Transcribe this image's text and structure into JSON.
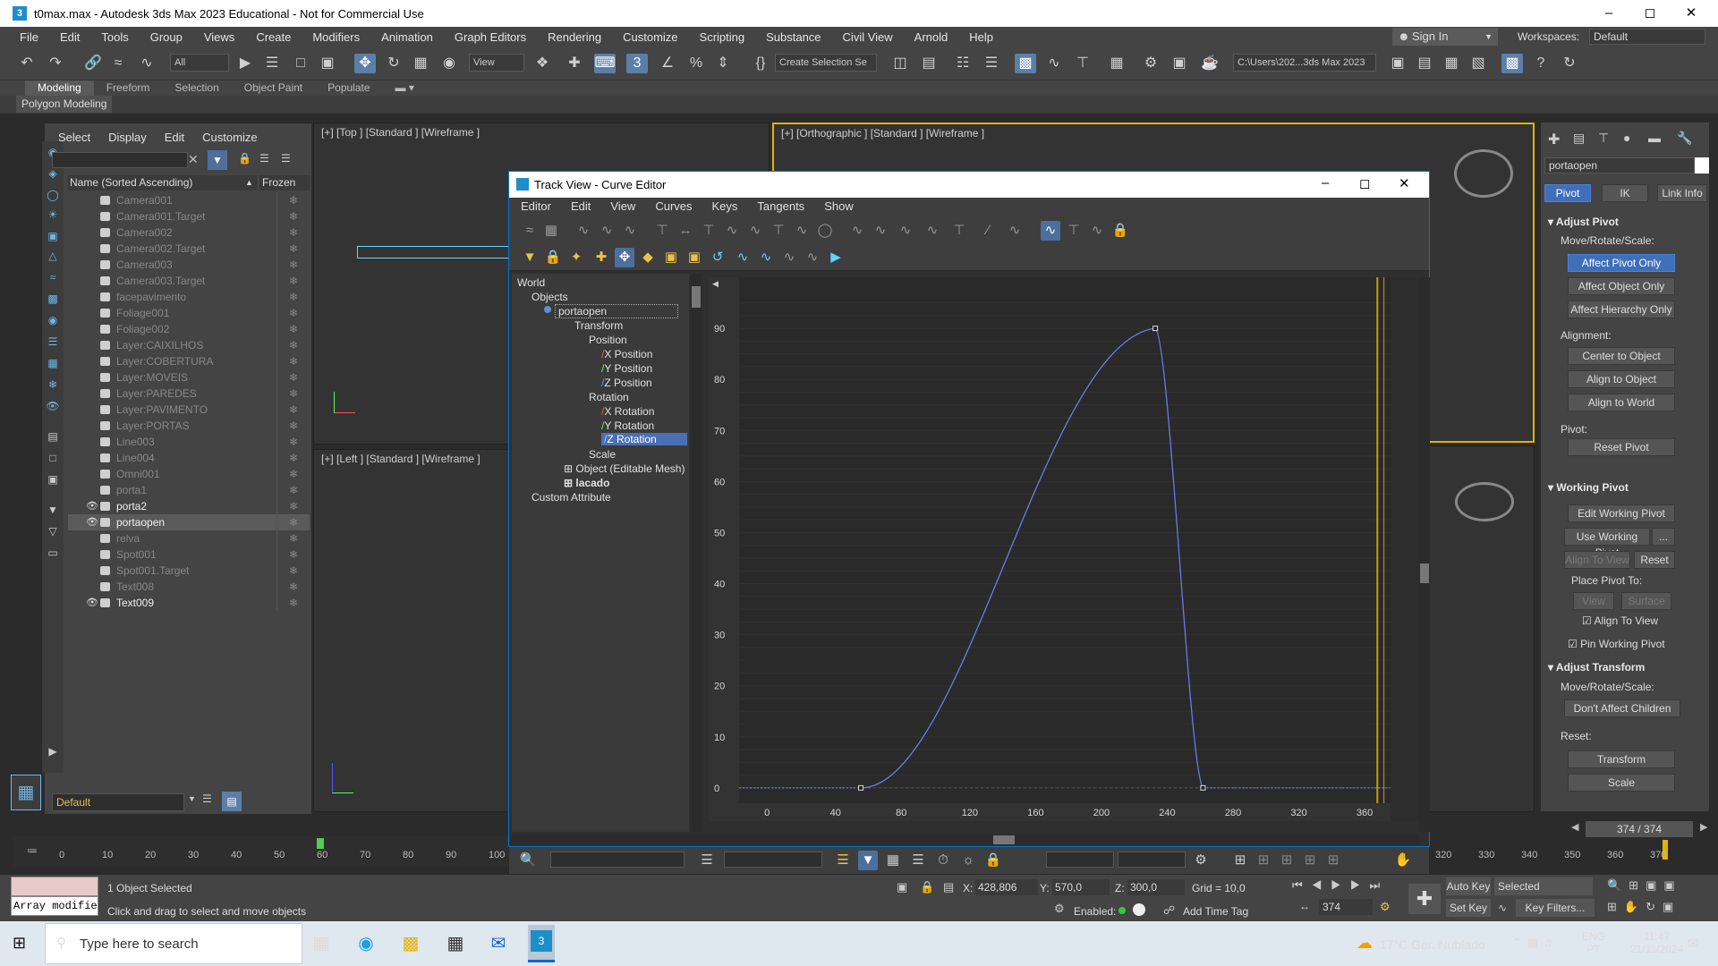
{
  "window": {
    "title": "t0max.max - Autodesk 3ds Max 2023 Educational - Not for Commercial Use",
    "app_icon": "3"
  },
  "menus": [
    "File",
    "Edit",
    "Tools",
    "Group",
    "Views",
    "Create",
    "Modifiers",
    "Animation",
    "Graph Editors",
    "Rendering",
    "Customize",
    "Scripting",
    "Substance",
    "Civil View",
    "Arnold",
    "Help"
  ],
  "account": {
    "sign_in": "Sign In",
    "workspaces_label": "Workspaces:",
    "workspace_value": "Default"
  },
  "toolbar": {
    "filter": "All",
    "ref_coord": "View",
    "selection_set": "Create Selection Se",
    "path": "C:\\Users\\202...3ds Max 2023"
  },
  "ribbon": {
    "tabs": [
      "Modeling",
      "Freeform",
      "Selection",
      "Object Paint",
      "Populate"
    ],
    "panel": "Polygon Modeling"
  },
  "scene_explorer": {
    "menu": [
      "Select",
      "Display",
      "Edit",
      "Customize"
    ],
    "col_name": "Name (Sorted Ascending)",
    "col_frozen": "Frozen",
    "items": [
      {
        "name": "Camera001",
        "vis": false
      },
      {
        "name": "Camera001.Target",
        "vis": false
      },
      {
        "name": "Camera002",
        "vis": false
      },
      {
        "name": "Camera002.Target",
        "vis": false
      },
      {
        "name": "Camera003",
        "vis": false
      },
      {
        "name": "Camera003.Target",
        "vis": false
      },
      {
        "name": "facepavimento",
        "vis": false
      },
      {
        "name": "Foliage001",
        "vis": false
      },
      {
        "name": "Foliage002",
        "vis": false
      },
      {
        "name": "Layer:CAIXILHOS",
        "vis": false
      },
      {
        "name": "Layer:COBERTURA",
        "vis": false
      },
      {
        "name": "Layer:MOVEIS",
        "vis": false
      },
      {
        "name": "Layer:PAREDES",
        "vis": false
      },
      {
        "name": "Layer:PAVIMENTO",
        "vis": false
      },
      {
        "name": "Layer:PORTAS",
        "vis": false
      },
      {
        "name": "Line003",
        "vis": false
      },
      {
        "name": "Line004",
        "vis": false
      },
      {
        "name": "Omni001",
        "vis": false
      },
      {
        "name": "porta1",
        "vis": false
      },
      {
        "name": "porta2",
        "vis": true
      },
      {
        "name": "portaopen",
        "vis": true,
        "selected": true
      },
      {
        "name": "relva",
        "vis": false
      },
      {
        "name": "Spot001",
        "vis": false
      },
      {
        "name": "Spot001.Target",
        "vis": false
      },
      {
        "name": "Text008",
        "vis": false
      },
      {
        "name": "Text009",
        "vis": true
      }
    ],
    "layer": "Default"
  },
  "viewports": {
    "top": "[+] [Top ] [Standard ] [Wireframe ]",
    "ortho": "[+] [Orthographic ] [Standard ] [Wireframe ]",
    "left": "[+] [Left ] [Standard ] [Wireframe ]"
  },
  "track_view": {
    "title": "Track View - Curve Editor",
    "menu": [
      "Editor",
      "Edit",
      "View",
      "Curves",
      "Keys",
      "Tangents",
      "Show"
    ],
    "tree": {
      "world": "World",
      "objects": "Objects",
      "object": "portaopen",
      "transform": "Transform",
      "position": "Position",
      "x_pos": "X Position",
      "y_pos": "Y Position",
      "z_pos": "Z Position",
      "rotation": "Rotation",
      "x_rot": "X Rotation",
      "y_rot": "Y Rotation",
      "z_rot": "Z Rotation",
      "scale": "Scale",
      "editable": "Object (Editable Mesh)",
      "lacado": "lacado",
      "custom": "Custom Attribute"
    },
    "chart_data": {
      "type": "line",
      "y_ticks": [
        0,
        10,
        20,
        30,
        40,
        50,
        60,
        70,
        80,
        90
      ],
      "x_ticks": [
        0,
        40,
        80,
        120,
        160,
        200,
        240,
        280,
        320,
        360
      ],
      "ylim": [
        -3,
        100
      ],
      "xlim": [
        -18,
        378
      ],
      "keys": [
        {
          "x": 56,
          "y": 0
        },
        {
          "x": 235,
          "y": 90
        },
        {
          "x": 264,
          "y": 0
        }
      ],
      "current_frame": 374,
      "end_frame": 370
    }
  },
  "command_panel": {
    "object_name": "portaopen",
    "tabs": [
      "Pivot",
      "IK",
      "Link Info"
    ],
    "adjust_pivot": "Adjust Pivot",
    "move_rotate_scale": "Move/Rotate/Scale:",
    "affect_pivot": "Affect Pivot Only",
    "affect_object": "Affect Object Only",
    "affect_hierarchy": "Affect Hierarchy Only",
    "alignment": "Alignment:",
    "center": "Center to Object",
    "align_obj": "Align to Object",
    "align_world": "Align to World",
    "pivot": "Pivot:",
    "reset_pivot": "Reset Pivot",
    "working_pivot": "Working Pivot",
    "edit_wp": "Edit Working Pivot",
    "use_wp": "Use Working Pivot",
    "dots": "...",
    "align_view": "Align To View",
    "reset": "Reset",
    "place_pivot": "Place Pivot To:",
    "view": "View",
    "surface": "Surface",
    "chk_align_view": "Align To View",
    "chk_pin": "Pin Working Pivot",
    "adjust_transform": "Adjust Transform",
    "move_rotate_scale2": "Move/Rotate/Scale:",
    "dont_affect": "Don't Affect Children",
    "reset2": "Reset:",
    "transform": "Transform",
    "scale": "Scale"
  },
  "timeline": {
    "ticks": [
      0,
      10,
      20,
      30,
      40,
      50,
      60,
      70,
      80,
      90,
      100
    ],
    "right_ticks": [
      320,
      330,
      340,
      350,
      360,
      370
    ],
    "frame_counter": "374 / 374"
  },
  "status": {
    "script": "Array modifie",
    "selected": "1 Object Selected",
    "hint": "Click and drag to select and move objects",
    "x_label": "X:",
    "x": "428,806",
    "y_label": "Y:",
    "y": "570,0",
    "z_label": "Z:",
    "z": "300,0",
    "grid": "Grid = 10,0",
    "enabled": "Enabled:",
    "add_time_tag": "Add Time Tag",
    "auto_key": "Auto Key",
    "set_key": "Set Key",
    "selected_dd": "Selected",
    "key_filters": "Key Filters...",
    "frame": "374"
  },
  "taskbar": {
    "search": "Type here to search",
    "weather": "17°C  Ger. Nublado",
    "lang": "ENG",
    "region": "PT",
    "time": "11:47",
    "date": "21/11/2024"
  }
}
